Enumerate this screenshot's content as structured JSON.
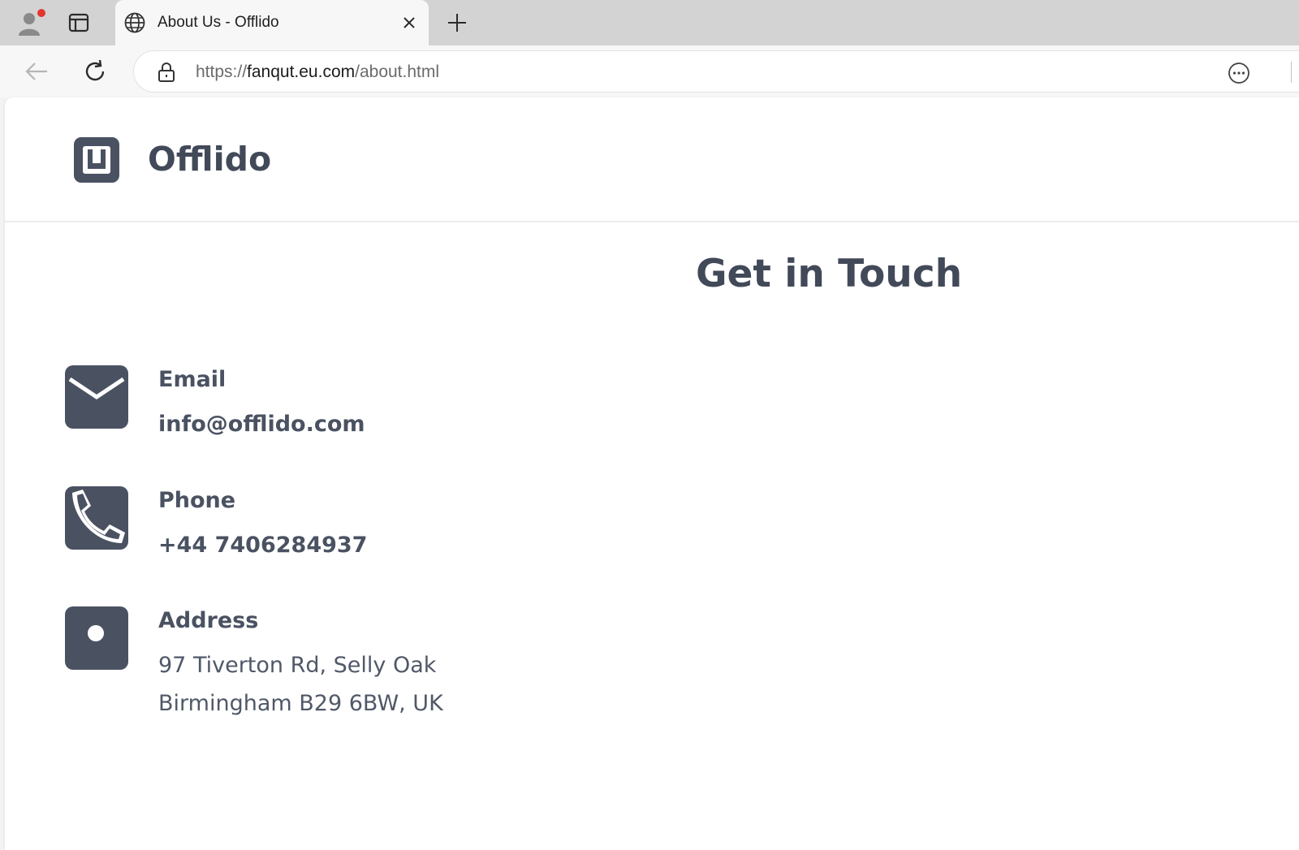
{
  "browser": {
    "tab": {
      "title": "About Us - Offlido"
    },
    "address": {
      "scheme": "https://",
      "host": "fanqut.eu.com",
      "path": "/about.html"
    },
    "icons": {
      "profile": "profile-icon",
      "tab_actions": "tab-actions-icon",
      "favicon": "globe-icon",
      "close": "close-icon",
      "new_tab": "plus-icon",
      "back": "back-arrow-icon",
      "reload": "reload-icon",
      "lock": "lock-icon",
      "more": "more-options-icon"
    }
  },
  "site": {
    "brand": "Offlido",
    "brand_color": "#4a5262"
  },
  "contact": {
    "title": "Get in Touch",
    "email": {
      "label": "Email",
      "value": "info@offlido.com"
    },
    "phone": {
      "label": "Phone",
      "value": "+44 7406284937"
    },
    "address": {
      "label": "Address",
      "line1": "97 Tiverton Rd, Selly Oak",
      "line2": "Birmingham B29 6BW, UK"
    }
  }
}
